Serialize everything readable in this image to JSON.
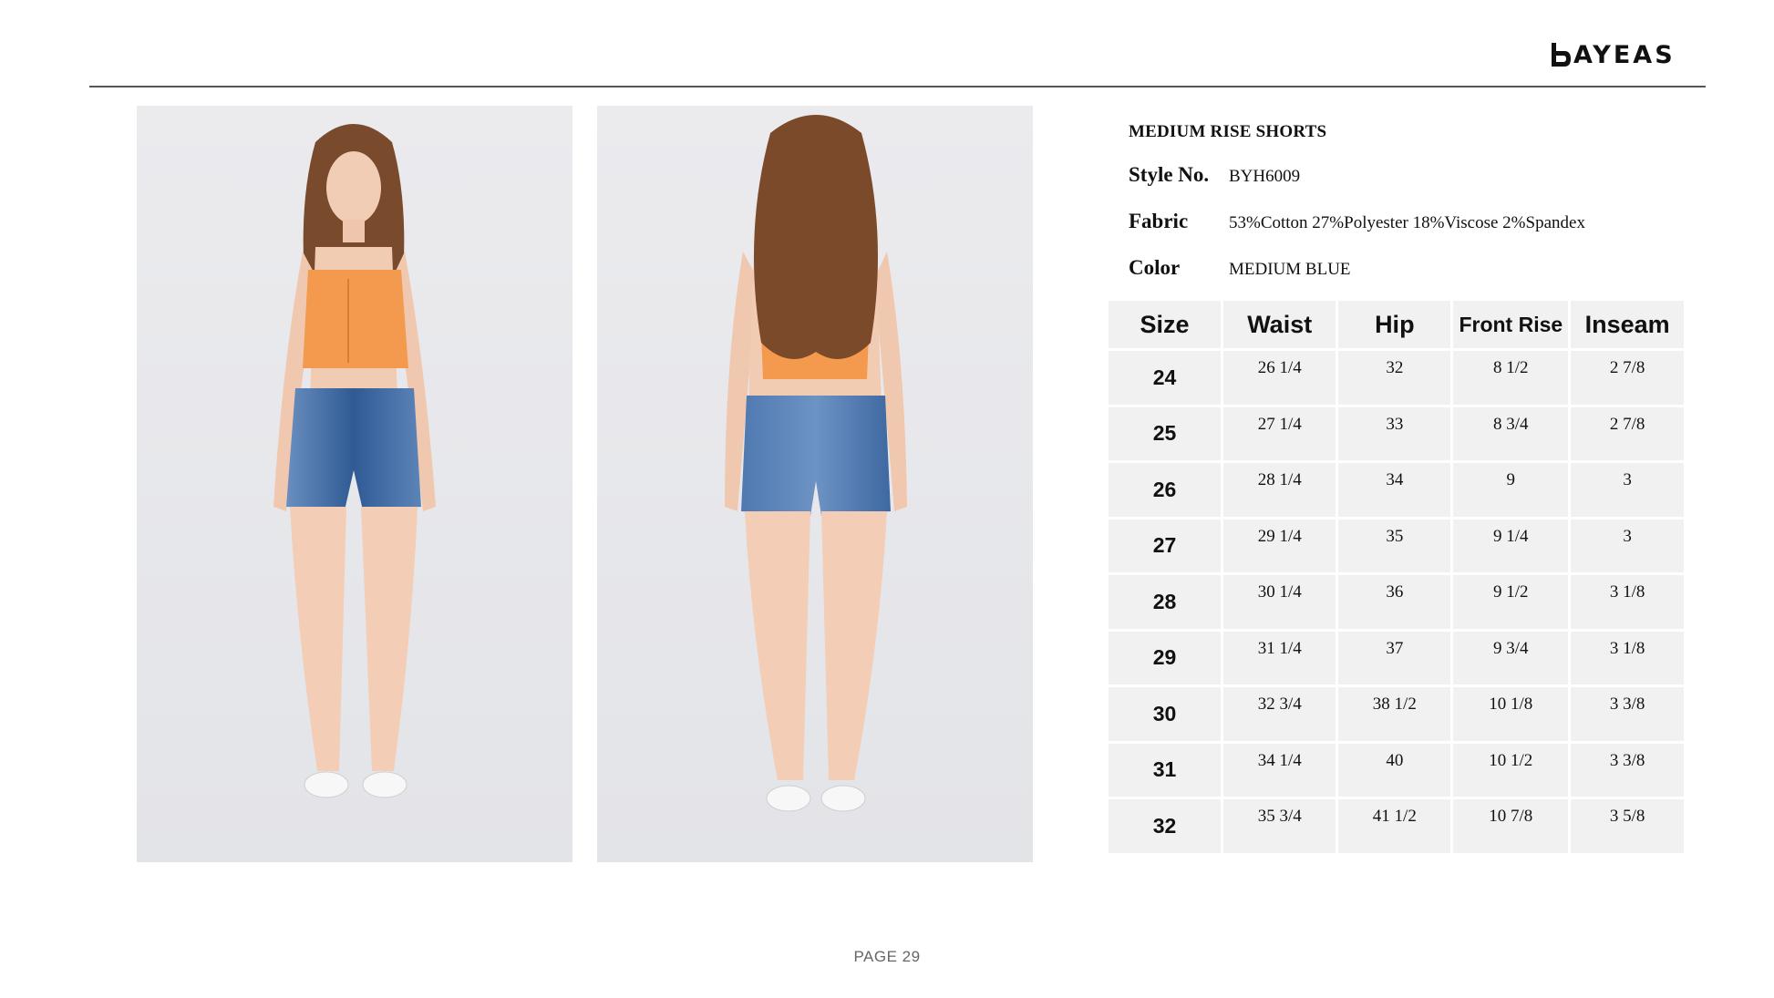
{
  "brand": {
    "name": "AYEAS",
    "logo_icon": "b-monogram-icon"
  },
  "product": {
    "title": "MEDIUM RISE SHORTS",
    "specs": [
      {
        "label": "Style No.",
        "value": "BYH6009"
      },
      {
        "label": "Fabric",
        "value": "53%Cotton 27%Polyester 18%Viscose 2%Spandex"
      },
      {
        "label": "Color",
        "value": "MEDIUM BLUE"
      }
    ]
  },
  "images": [
    {
      "name": "front-view-photo"
    },
    {
      "name": "back-view-photo"
    }
  ],
  "size_chart": {
    "headers": [
      "Size",
      "Waist",
      "Hip",
      "Front Rise",
      "Inseam"
    ],
    "rows": [
      [
        "24",
        "26 1/4",
        "32",
        "8 1/2",
        "2 7/8"
      ],
      [
        "25",
        "27 1/4",
        "33",
        "8 3/4",
        "2 7/8"
      ],
      [
        "26",
        "28 1/4",
        "34",
        "9",
        "3"
      ],
      [
        "27",
        "29 1/4",
        "35",
        "9 1/4",
        "3"
      ],
      [
        "28",
        "30 1/4",
        "36",
        "9 1/2",
        "3 1/8"
      ],
      [
        "29",
        "31 1/4",
        "37",
        "9 3/4",
        "3 1/8"
      ],
      [
        "30",
        "32 3/4",
        "38 1/2",
        "10 1/8",
        "3 3/8"
      ],
      [
        "31",
        "34 1/4",
        "40",
        "10 1/2",
        "3 3/8"
      ],
      [
        "32",
        "35 3/4",
        "41 1/2",
        "10 7/8",
        "3 5/8"
      ]
    ]
  },
  "footer": {
    "page_label": "PAGE 29"
  },
  "colors": {
    "top": "#f39a4f",
    "denim": "#3d6aa3",
    "table_bg": "#f1f1f1",
    "rule": "#555555"
  }
}
